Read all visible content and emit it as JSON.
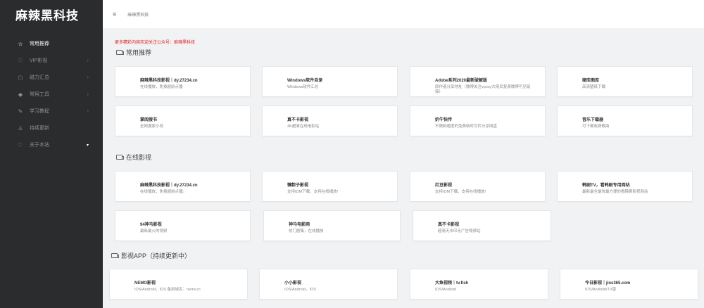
{
  "sidebar": {
    "logo": "麻辣黑科技",
    "items": [
      {
        "icon": "☆",
        "label": "常用推荐",
        "arrow": ""
      },
      {
        "icon": "♡",
        "label": "VIP影视",
        "arrow": "›"
      },
      {
        "icon": "☖",
        "label": "磁力汇总",
        "arrow": "›"
      },
      {
        "icon": "◆",
        "label": "常用工具",
        "arrow": "›"
      },
      {
        "icon": "✎",
        "label": "学习教程",
        "arrow": "›"
      },
      {
        "icon": "♙",
        "label": "持续更新",
        "arrow": ""
      },
      {
        "icon": "♡",
        "label": "关于本站",
        "arrow": "▾"
      }
    ]
  },
  "header": {
    "menu_icon": "≡",
    "breadcrumb": "麻辣黑科技"
  },
  "notice": "更多精彩内容欢迎关注公众号：麻辣黑科技",
  "sections": [
    {
      "title": "常用推荐",
      "cards": [
        {
          "title": "麻辣黑科技影视｜dy.27234.cn",
          "desc": "在线播放，免费超前点播"
        },
        {
          "title": "Windows软件目录",
          "desc": "Windows软件汇总"
        },
        {
          "title": "Adobe系列2020最新破解版",
          "desc": "原作者分享地址（微博关注vposy大佬后复原微博可见链接）"
        },
        {
          "title": "硬库图库",
          "desc": "高清壁纸下载"
        },
        {
          "title": "掌阅搜书",
          "desc": "全网搜索小说"
        },
        {
          "title": "真不卡影视",
          "desc": "4K超清在线电影站"
        },
        {
          "title": "奶牛快传",
          "desc": "不限制速度的免费临时文件分享网盘"
        },
        {
          "title": "音乐下载器",
          "desc": "可下载收费歌曲"
        }
      ]
    },
    {
      "title": "在线影视",
      "cards": [
        {
          "title": "麻辣黑科技影视｜dy.27234.cn",
          "desc": "在线播放，免费超前点播。"
        },
        {
          "title": "懒粽子影视",
          "desc": "支持IDM下载，支持在线播放!"
        },
        {
          "title": "红豆影视",
          "desc": "支持IDM下载，支持在线播放!"
        },
        {
          "title": "韩剧TV，看韩剧专用网站",
          "desc": "最新最全最快最方便的看韩剧影视网站"
        },
        {
          "title": "94神马影视",
          "desc": "最新最火的视频"
        },
        {
          "title": "神马电影网",
          "desc": "热门剧集，在线播放"
        },
        {
          "title": "真不卡影视",
          "desc": "超清无水印无广告视频站"
        }
      ]
    },
    {
      "title": "影视APP（持续更新中）",
      "cards": [
        {
          "title": "NEMO影视",
          "desc": "IOS/Android，IOS 备用域名：nemv.cc"
        },
        {
          "title": "小小影视",
          "desc": "IOS/Android，IOS"
        },
        {
          "title": "大鱼视频｜tv.fish",
          "desc": "IOS/Android"
        },
        {
          "title": "今日影视｜jins365.com",
          "desc": "IOS/Android/TV版"
        }
      ]
    }
  ]
}
